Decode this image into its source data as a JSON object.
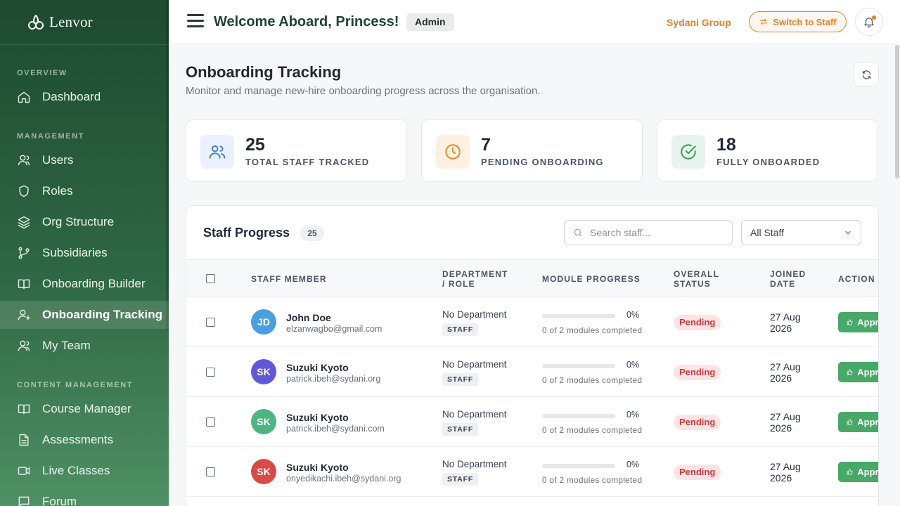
{
  "brand": {
    "name": "Lenvor",
    "icon": "lotus-logo-icon"
  },
  "sidebar": {
    "sections": [
      {
        "label": "OVERVIEW"
      },
      {
        "label": "MANAGEMENT"
      },
      {
        "label": "CONTENT MANAGEMENT"
      }
    ],
    "items": [
      {
        "label": "Dashboard",
        "icon": "home-icon"
      },
      {
        "label": "Users",
        "icon": "user-icon"
      },
      {
        "label": "Roles",
        "icon": "shield-icon"
      },
      {
        "label": "Org Structure",
        "icon": "layers-icon"
      },
      {
        "label": "Subsidiaries",
        "icon": "git-branch-icon"
      },
      {
        "label": "Onboarding Builder",
        "icon": "book-open-icon"
      },
      {
        "label": "Onboarding Tracking",
        "icon": "user-plus-icon",
        "active": true
      },
      {
        "label": "My Team",
        "icon": "users-icon"
      },
      {
        "label": "Course Manager",
        "icon": "book-icon"
      },
      {
        "label": "Assessments",
        "icon": "file-text-icon"
      },
      {
        "label": "Live Classes",
        "icon": "video-icon"
      },
      {
        "label": "Forum",
        "icon": "message-square-icon"
      }
    ]
  },
  "header": {
    "welcome": "Welcome Aboard, Princess!",
    "role_badge": "Admin",
    "org": "Sydani Group",
    "switch_label": "Switch to Staff",
    "accent": "#e0812b"
  },
  "page": {
    "title": "Onboarding Tracking",
    "subtitle": "Monitor and manage new-hire onboarding progress across the organisation."
  },
  "stats": [
    {
      "value": "25",
      "label": "TOTAL STAFF TRACKED",
      "icon": "users-icon",
      "color": "#4a7cd6",
      "bg": "#eaf1fd"
    },
    {
      "value": "7",
      "label": "PENDING ONBOARDING",
      "icon": "clock-icon",
      "color": "#e38a2a",
      "bg": "#fdf1e3"
    },
    {
      "value": "18",
      "label": "FULLY ONBOARDED",
      "icon": "check-circle-icon",
      "color": "#3a9a62",
      "bg": "#e7f4ec"
    }
  ],
  "table": {
    "title": "Staff Progress",
    "count": "25",
    "search_placeholder": "Search staff...",
    "filter": "All Staff",
    "headers": {
      "member": "STAFF MEMBER",
      "dept_1": "DEPARTMENT",
      "dept_2": "/ ROLE",
      "progress": "MODULE PROGRESS",
      "status_1": "OVERALL",
      "status_2": "STATUS",
      "joined_1": "JOINED",
      "joined_2": "DATE",
      "action": "ACTION"
    },
    "rows": [
      {
        "initials": "JD",
        "avatar_color": "#4a9fe0",
        "name": "John Doe",
        "email": "elzanwagbo@gmail.com",
        "department": "No Department",
        "role": "STAFF",
        "progress": 0,
        "progress_pct": "0%",
        "progress_note": "0 of 2 modules completed",
        "status": "Pending",
        "joined_1": "27 Aug",
        "joined_2": "2026",
        "action": "Approve"
      },
      {
        "initials": "SK",
        "avatar_color": "#6158d8",
        "name": "Suzuki Kyoto",
        "email": "patrick.ibeh@sydani.org",
        "department": "No Department",
        "role": "STAFF",
        "progress": 0,
        "progress_pct": "0%",
        "progress_note": "0 of 2 modules completed",
        "status": "Pending",
        "joined_1": "27 Aug",
        "joined_2": "2026",
        "action": "Approve"
      },
      {
        "initials": "SK",
        "avatar_color": "#4fb483",
        "name": "Suzuki Kyoto",
        "email": "patrick.ibeh@sydani.com",
        "department": "No Department",
        "role": "STAFF",
        "progress": 0,
        "progress_pct": "0%",
        "progress_note": "0 of 2 modules completed",
        "status": "Pending",
        "joined_1": "27 Aug",
        "joined_2": "2026",
        "action": "Approve"
      },
      {
        "initials": "SK",
        "avatar_color": "#d94a47",
        "name": "Suzuki Kyoto",
        "email": "onyedikachi.ibeh@sydani.org",
        "department": "No Department",
        "role": "STAFF",
        "progress": 0,
        "progress_pct": "0%",
        "progress_note": "0 of 2 modules completed",
        "status": "Pending",
        "joined_1": "27 Aug",
        "joined_2": "2026",
        "action": "Approve"
      }
    ]
  }
}
